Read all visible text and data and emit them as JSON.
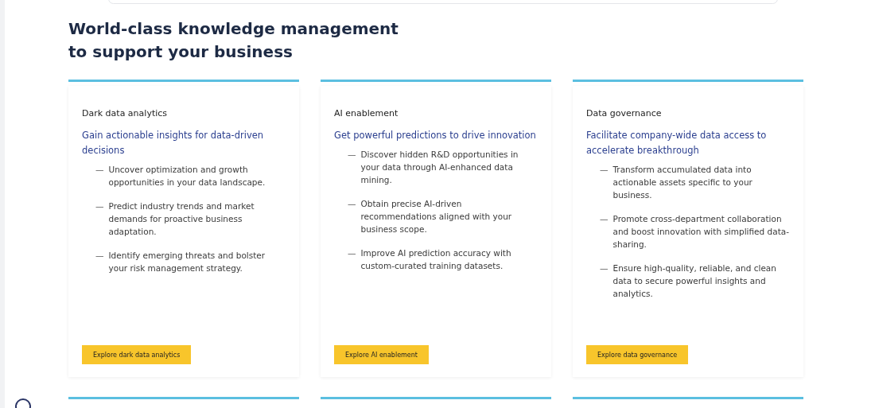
{
  "heading": "World-class knowledge management to support your business",
  "cards": [
    {
      "title": "Dark data analytics",
      "subtitle": "Gain actionable insights for data-driven decisions",
      "points": [
        "Uncover optimization and growth opportunities in your data landscape.",
        "Predict industry trends and market demands for proactive business adaptation.",
        "Identify emerging threats and bolster your risk management strategy."
      ],
      "button": "Explore dark data analytics"
    },
    {
      "title": "AI enablement",
      "subtitle": "Get powerful predictions to drive innovation",
      "points": [
        "Discover hidden R&D opportunities in your data through AI-enhanced data mining.",
        "Obtain precise AI-driven recommendations aligned with your business scope.",
        "Improve AI prediction accuracy with custom-curated training datasets."
      ],
      "button": "Explore AI enablement"
    },
    {
      "title": "Data governance",
      "subtitle": "Facilitate company-wide data access to accelerate breakthrough",
      "points": [
        "Transform accumulated data into actionable assets specific to your business.",
        "Promote cross-department collaboration and boost innovation with simplified data-sharing.",
        "Ensure high-quality, reliable, and clean data to secure powerful insights and analytics."
      ],
      "button": "Explore data governance"
    }
  ],
  "dash": "—"
}
